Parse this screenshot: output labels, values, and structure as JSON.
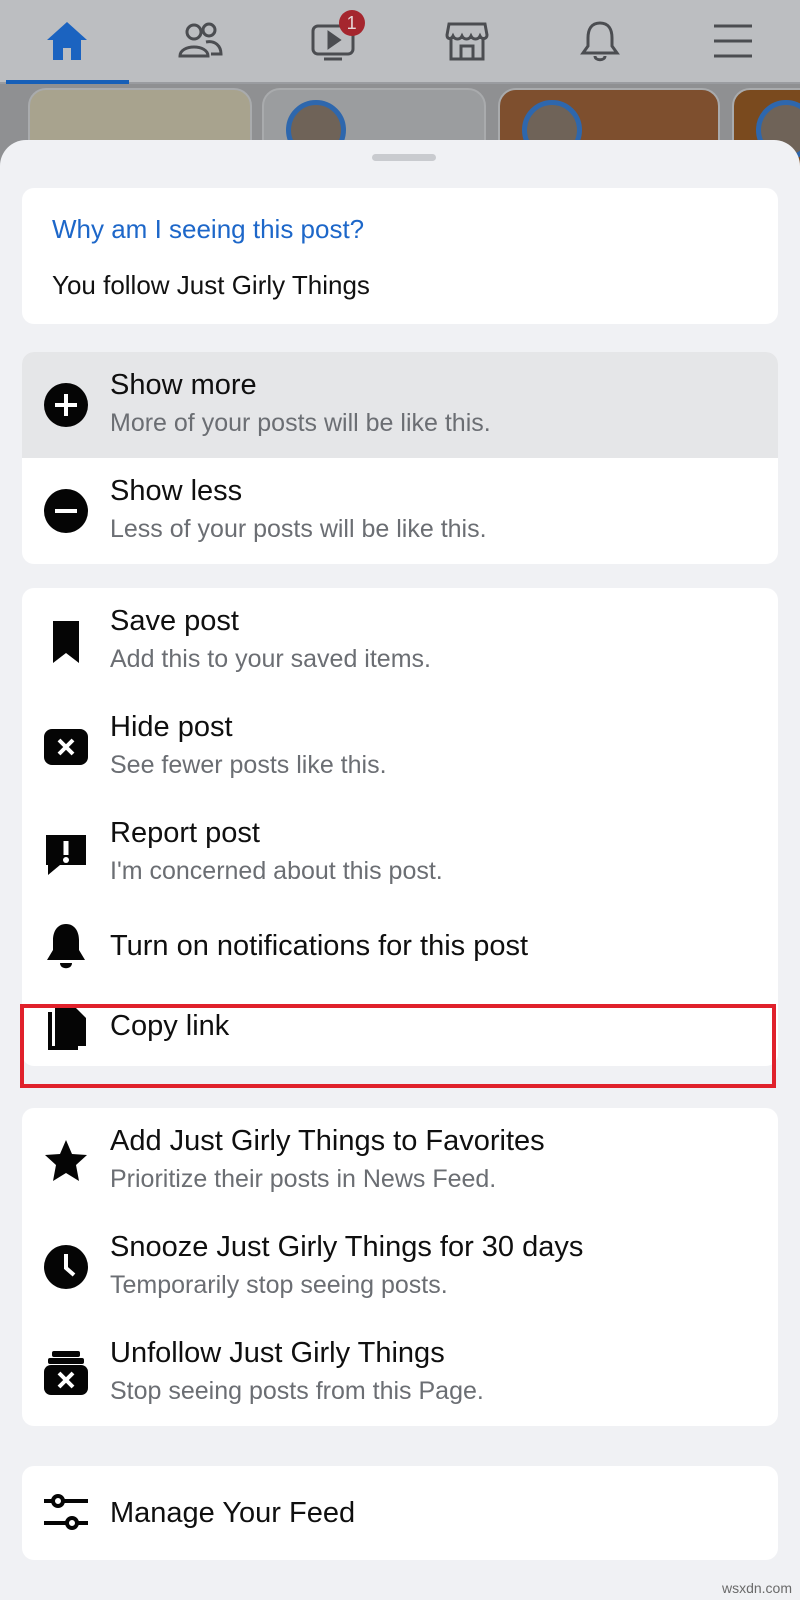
{
  "nav": {
    "items": [
      {
        "name": "home-icon",
        "active": true
      },
      {
        "name": "friends-icon"
      },
      {
        "name": "watch-icon",
        "badge": "1"
      },
      {
        "name": "marketplace-icon"
      },
      {
        "name": "notifications-bell-icon"
      },
      {
        "name": "menu-icon"
      }
    ]
  },
  "why": {
    "title": "Why am I seeing this post?",
    "subtitle": "You follow Just Girly Things"
  },
  "group1": [
    {
      "icon": "plus-circle-icon",
      "title": "Show more",
      "subtitle": "More of your posts will be like this.",
      "highlighted": true
    },
    {
      "icon": "minus-circle-icon",
      "title": "Show less",
      "subtitle": "Less of your posts will be like this."
    }
  ],
  "group2": [
    {
      "icon": "bookmark-icon",
      "title": "Save post",
      "subtitle": "Add this to your saved items."
    },
    {
      "icon": "hide-x-box-icon",
      "title": "Hide post",
      "subtitle": "See fewer posts like this."
    },
    {
      "icon": "report-exclamation-icon",
      "title": "Report post",
      "subtitle": "I'm concerned about this post."
    },
    {
      "icon": "bell-icon",
      "title": "Turn on notifications for this post"
    },
    {
      "icon": "copy-link-icon",
      "title": "Copy link"
    }
  ],
  "group3": [
    {
      "icon": "star-icon",
      "title": "Add Just Girly Things to Favorites",
      "subtitle": "Prioritize their posts in News Feed."
    },
    {
      "icon": "clock-icon",
      "title": "Snooze Just Girly Things for 30 days",
      "subtitle": "Temporarily stop seeing posts."
    },
    {
      "icon": "unfollow-box-icon",
      "title": "Unfollow Just Girly Things",
      "subtitle": "Stop seeing posts from this Page."
    }
  ],
  "group4": [
    {
      "icon": "sliders-icon",
      "title": "Manage Your Feed"
    }
  ],
  "colors": {
    "accent": "#1d67c9",
    "highlight_border": "#e0212b"
  },
  "watermark": "wsxdn.com"
}
